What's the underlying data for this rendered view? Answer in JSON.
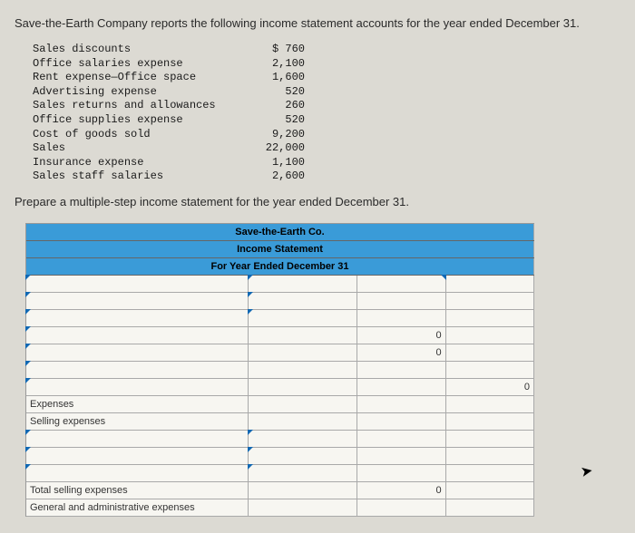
{
  "intro": "Save-the-Earth Company reports the following income statement accounts for the year ended December 31.",
  "accounts": [
    {
      "label": "Sales discounts",
      "value": "$ 760"
    },
    {
      "label": "Office salaries expense",
      "value": "2,100"
    },
    {
      "label": "Rent expense—Office space",
      "value": "1,600"
    },
    {
      "label": "Advertising expense",
      "value": "520"
    },
    {
      "label": "Sales returns and allowances",
      "value": "260"
    },
    {
      "label": "Office supplies expense",
      "value": "520"
    },
    {
      "label": "Cost of goods sold",
      "value": "9,200"
    },
    {
      "label": "Sales",
      "value": "22,000"
    },
    {
      "label": "Insurance expense",
      "value": "1,100"
    },
    {
      "label": "Sales staff salaries",
      "value": "2,600"
    }
  ],
  "instruction": "Prepare a multiple-step income statement for the year ended December 31.",
  "sheet": {
    "title1": "Save-the-Earth Co.",
    "title2": "Income Statement",
    "title3": "For Year Ended December 31",
    "rows": {
      "zero": "0",
      "expenses": "Expenses",
      "selling": "Selling expenses",
      "total_selling": "Total selling expenses",
      "ga": "General and administrative expenses"
    }
  }
}
